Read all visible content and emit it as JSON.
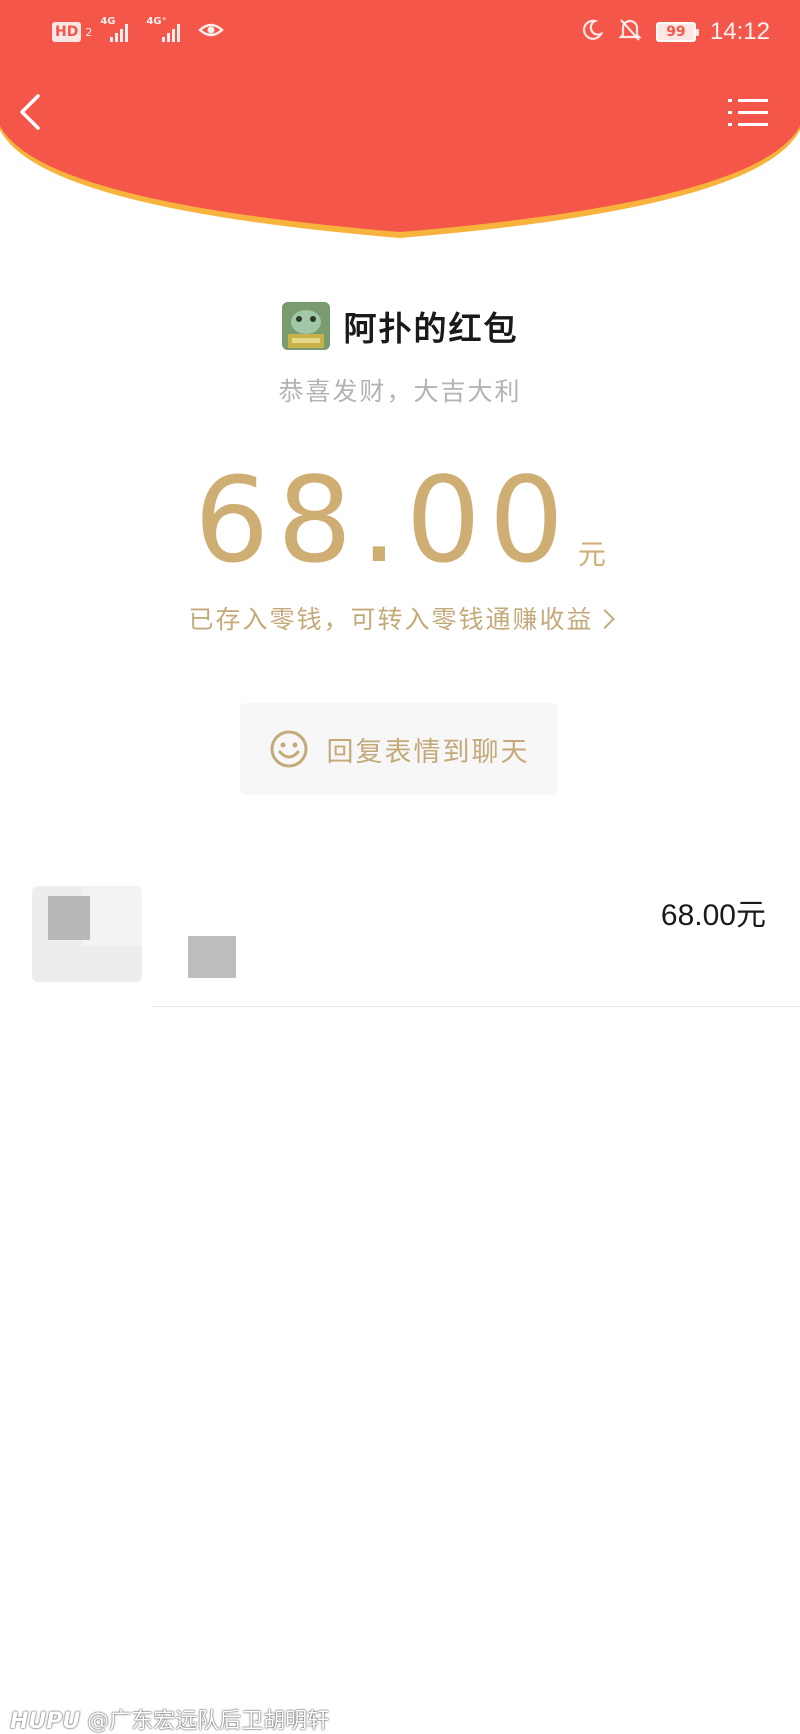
{
  "status_bar": {
    "hd_badge": "HD",
    "sim_slot": "2",
    "signal1_label": "4G",
    "signal2_label": "4G⁺",
    "battery": "99",
    "time": "14:12"
  },
  "colors": {
    "header_red": "#f4574a",
    "header_edge": "#f7b33c",
    "gold": "#cfae74",
    "gold_text": "#c4aa79"
  },
  "nav": {
    "back_icon": "chevron-left-icon",
    "menu_icon": "list-menu-icon"
  },
  "packet": {
    "sender": "阿扑的红包",
    "blessing": "恭喜发财，大吉大利",
    "amount": "68.00",
    "unit": "元",
    "wallet_link": "已存入零钱，可转入零钱通赚收益",
    "reply_button": "回复表情到聊天",
    "reply_icon": "smiley-icon"
  },
  "records": [
    {
      "amount": "68.00元"
    }
  ],
  "watermark": {
    "brand": "HUPU",
    "text": "@广东宏远队后卫胡明轩"
  }
}
